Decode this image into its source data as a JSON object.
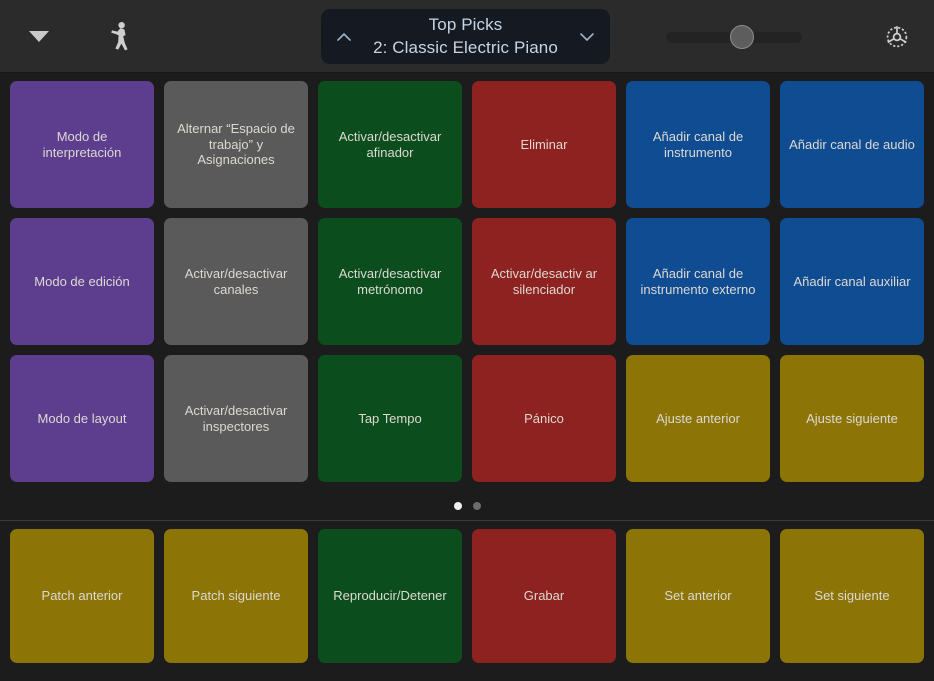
{
  "toolbar": {
    "menu_button": {
      "icon": "triangle-down-icon",
      "label": "Menú"
    },
    "performer_button": {
      "icon": "performer-icon",
      "label": "Modo de interpretación"
    },
    "patch_selector": {
      "collection": "Top Picks",
      "patch": "2: Classic Electric Piano",
      "up_icon": "chevron-up-icon",
      "down_icon": "chevron-down-icon"
    },
    "volume_slider": {
      "icon": "slider-icon",
      "value": 57
    },
    "settings_button": {
      "icon": "gear-icon",
      "label": "Ajustes"
    }
  },
  "colors": {
    "purple": "#5d3d8e",
    "gray": "#5a5a5a",
    "green": "#0b4d1c",
    "red": "#8e2220",
    "blue": "#0f4c91",
    "olive": "#8c7406",
    "background": "#1c1c1c",
    "toolbar": "#2b2b2b",
    "patch_bg": "#151a22",
    "text": "#ddd9d2"
  },
  "grid": {
    "rows": [
      [
        {
          "label": "Modo de interpretación",
          "color": "purple"
        },
        {
          "label": "Alternar “Espacio de trabajo” y Asignaciones",
          "color": "gray"
        },
        {
          "label": "Activar/desactivar afinador",
          "color": "green"
        },
        {
          "label": "Eliminar",
          "color": "red"
        },
        {
          "label": "Añadir canal de instrumento",
          "color": "blue"
        },
        {
          "label": "Añadir canal de audio",
          "color": "blue"
        }
      ],
      [
        {
          "label": "Modo de edición",
          "color": "purple"
        },
        {
          "label": "Activar/desactivar canales",
          "color": "gray"
        },
        {
          "label": "Activar/desactivar metrónomo",
          "color": "green"
        },
        {
          "label": "Activar/desactiv ar silenciador",
          "color": "red"
        },
        {
          "label": "Añadir canal de instrumento externo",
          "color": "blue"
        },
        {
          "label": "Añadir canal auxiliar",
          "color": "blue"
        }
      ],
      [
        {
          "label": "Modo de layout",
          "color": "purple"
        },
        {
          "label": "Activar/desactivar inspectores",
          "color": "gray"
        },
        {
          "label": "Tap Tempo",
          "color": "green"
        },
        {
          "label": "Pánico",
          "color": "red"
        },
        {
          "label": "Ajuste anterior",
          "color": "olive"
        },
        {
          "label": "Ajuste siguiente",
          "color": "olive"
        }
      ]
    ]
  },
  "pagination": {
    "pages": 2,
    "current": 1
  },
  "transport": {
    "buttons": [
      {
        "label": "Patch anterior",
        "color": "olive"
      },
      {
        "label": "Patch siguiente",
        "color": "olive"
      },
      {
        "label": "Reproducir/Detener",
        "color": "green"
      },
      {
        "label": "Grabar",
        "color": "red"
      },
      {
        "label": "Set anterior",
        "color": "olive"
      },
      {
        "label": "Set siguiente",
        "color": "olive"
      }
    ]
  }
}
